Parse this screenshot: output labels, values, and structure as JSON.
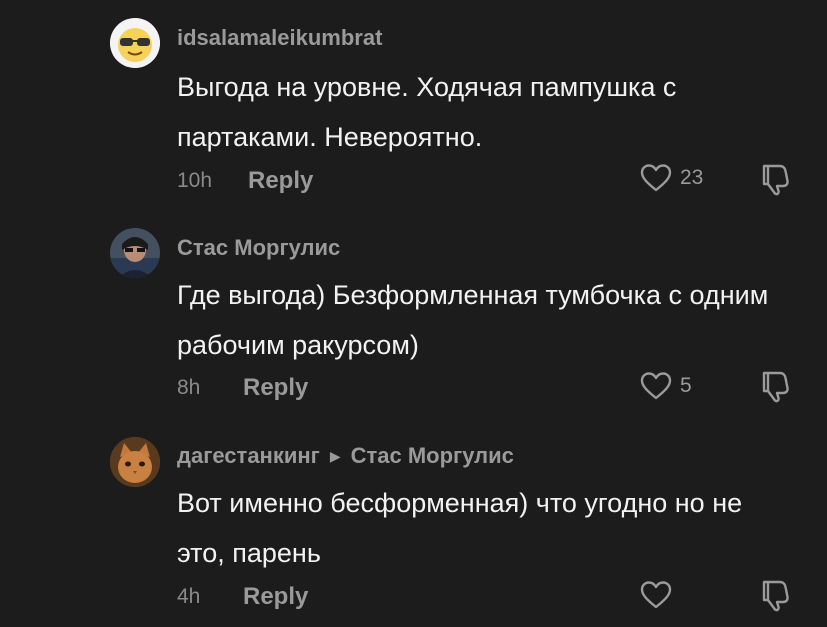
{
  "comments": [
    {
      "username": "idsalamaleikumbrat",
      "reply_to": "",
      "text": "Выгода на уровне. Ходячая пампушка с партаками. Невероятно.",
      "time": "10h",
      "reply_label": "Reply",
      "likes": "23",
      "avatar_icon": "sunglasses-emoji-icon"
    },
    {
      "username": "Стас Моргулис",
      "reply_to": "",
      "text": "Где выгода) Безформленная тумбочка с одним рабочим ракурсом)",
      "time": "8h",
      "reply_label": "Reply",
      "likes": "5",
      "avatar_icon": "person-photo-icon"
    },
    {
      "username": "дагестанкинг",
      "reply_to": "Стас Моргулис",
      "text": "Вот именно бесформенная) что угодно но не это, парень",
      "time": "4h",
      "reply_label": "Reply",
      "likes": "",
      "avatar_icon": "cat-photo-icon"
    }
  ],
  "colors": {
    "background": "#1c1c1c",
    "text": "#f2f2f2",
    "muted": "#9a9a9a"
  }
}
